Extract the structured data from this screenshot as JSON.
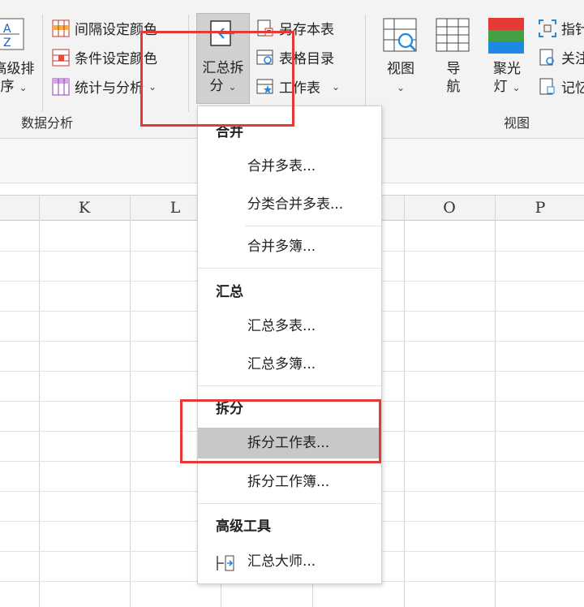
{
  "ribbon": {
    "sort_label_1": "高级排",
    "sort_label_2": "序",
    "btn_interval_color": "间隔设定颜色",
    "btn_condition_color": "条件设定颜色",
    "btn_stat_analysis": "统计与分析",
    "group_data_analysis": "数据分析",
    "summary_split_1": "汇总拆",
    "summary_split_2": "分",
    "btn_save_sheet": "另存本表",
    "btn_table_dir": "表格目录",
    "btn_worksheet": "工作表",
    "btn_view": "视图",
    "btn_nav_1": "导",
    "btn_nav_2": "航",
    "btn_spotlight_1": "聚光",
    "btn_spotlight_2": "灯",
    "btn_pointer": "指针",
    "btn_focus": "关注",
    "btn_memo": "记忆",
    "group_view": "视图"
  },
  "columns": [
    "K",
    "L",
    "O",
    "P"
  ],
  "menu": {
    "merge_header": "合并",
    "merge_sheets": "合并多表...",
    "merge_by_category": "分类合并多表...",
    "merge_books": "合并多簿...",
    "summary_header": "汇总",
    "summary_sheets": "汇总多表...",
    "summary_books": "汇总多簿...",
    "split_header": "拆分",
    "split_worksheet": "拆分工作表...",
    "split_workbook": "拆分工作簿...",
    "advanced_header": "高级工具",
    "summary_master": "汇总大师..."
  },
  "colors": {
    "highlight_box": "#e53935",
    "selected_item": "#c8c8c8",
    "spotlight_red": "#e53935",
    "spotlight_green": "#43a047",
    "spotlight_blue": "#1e88e5"
  }
}
